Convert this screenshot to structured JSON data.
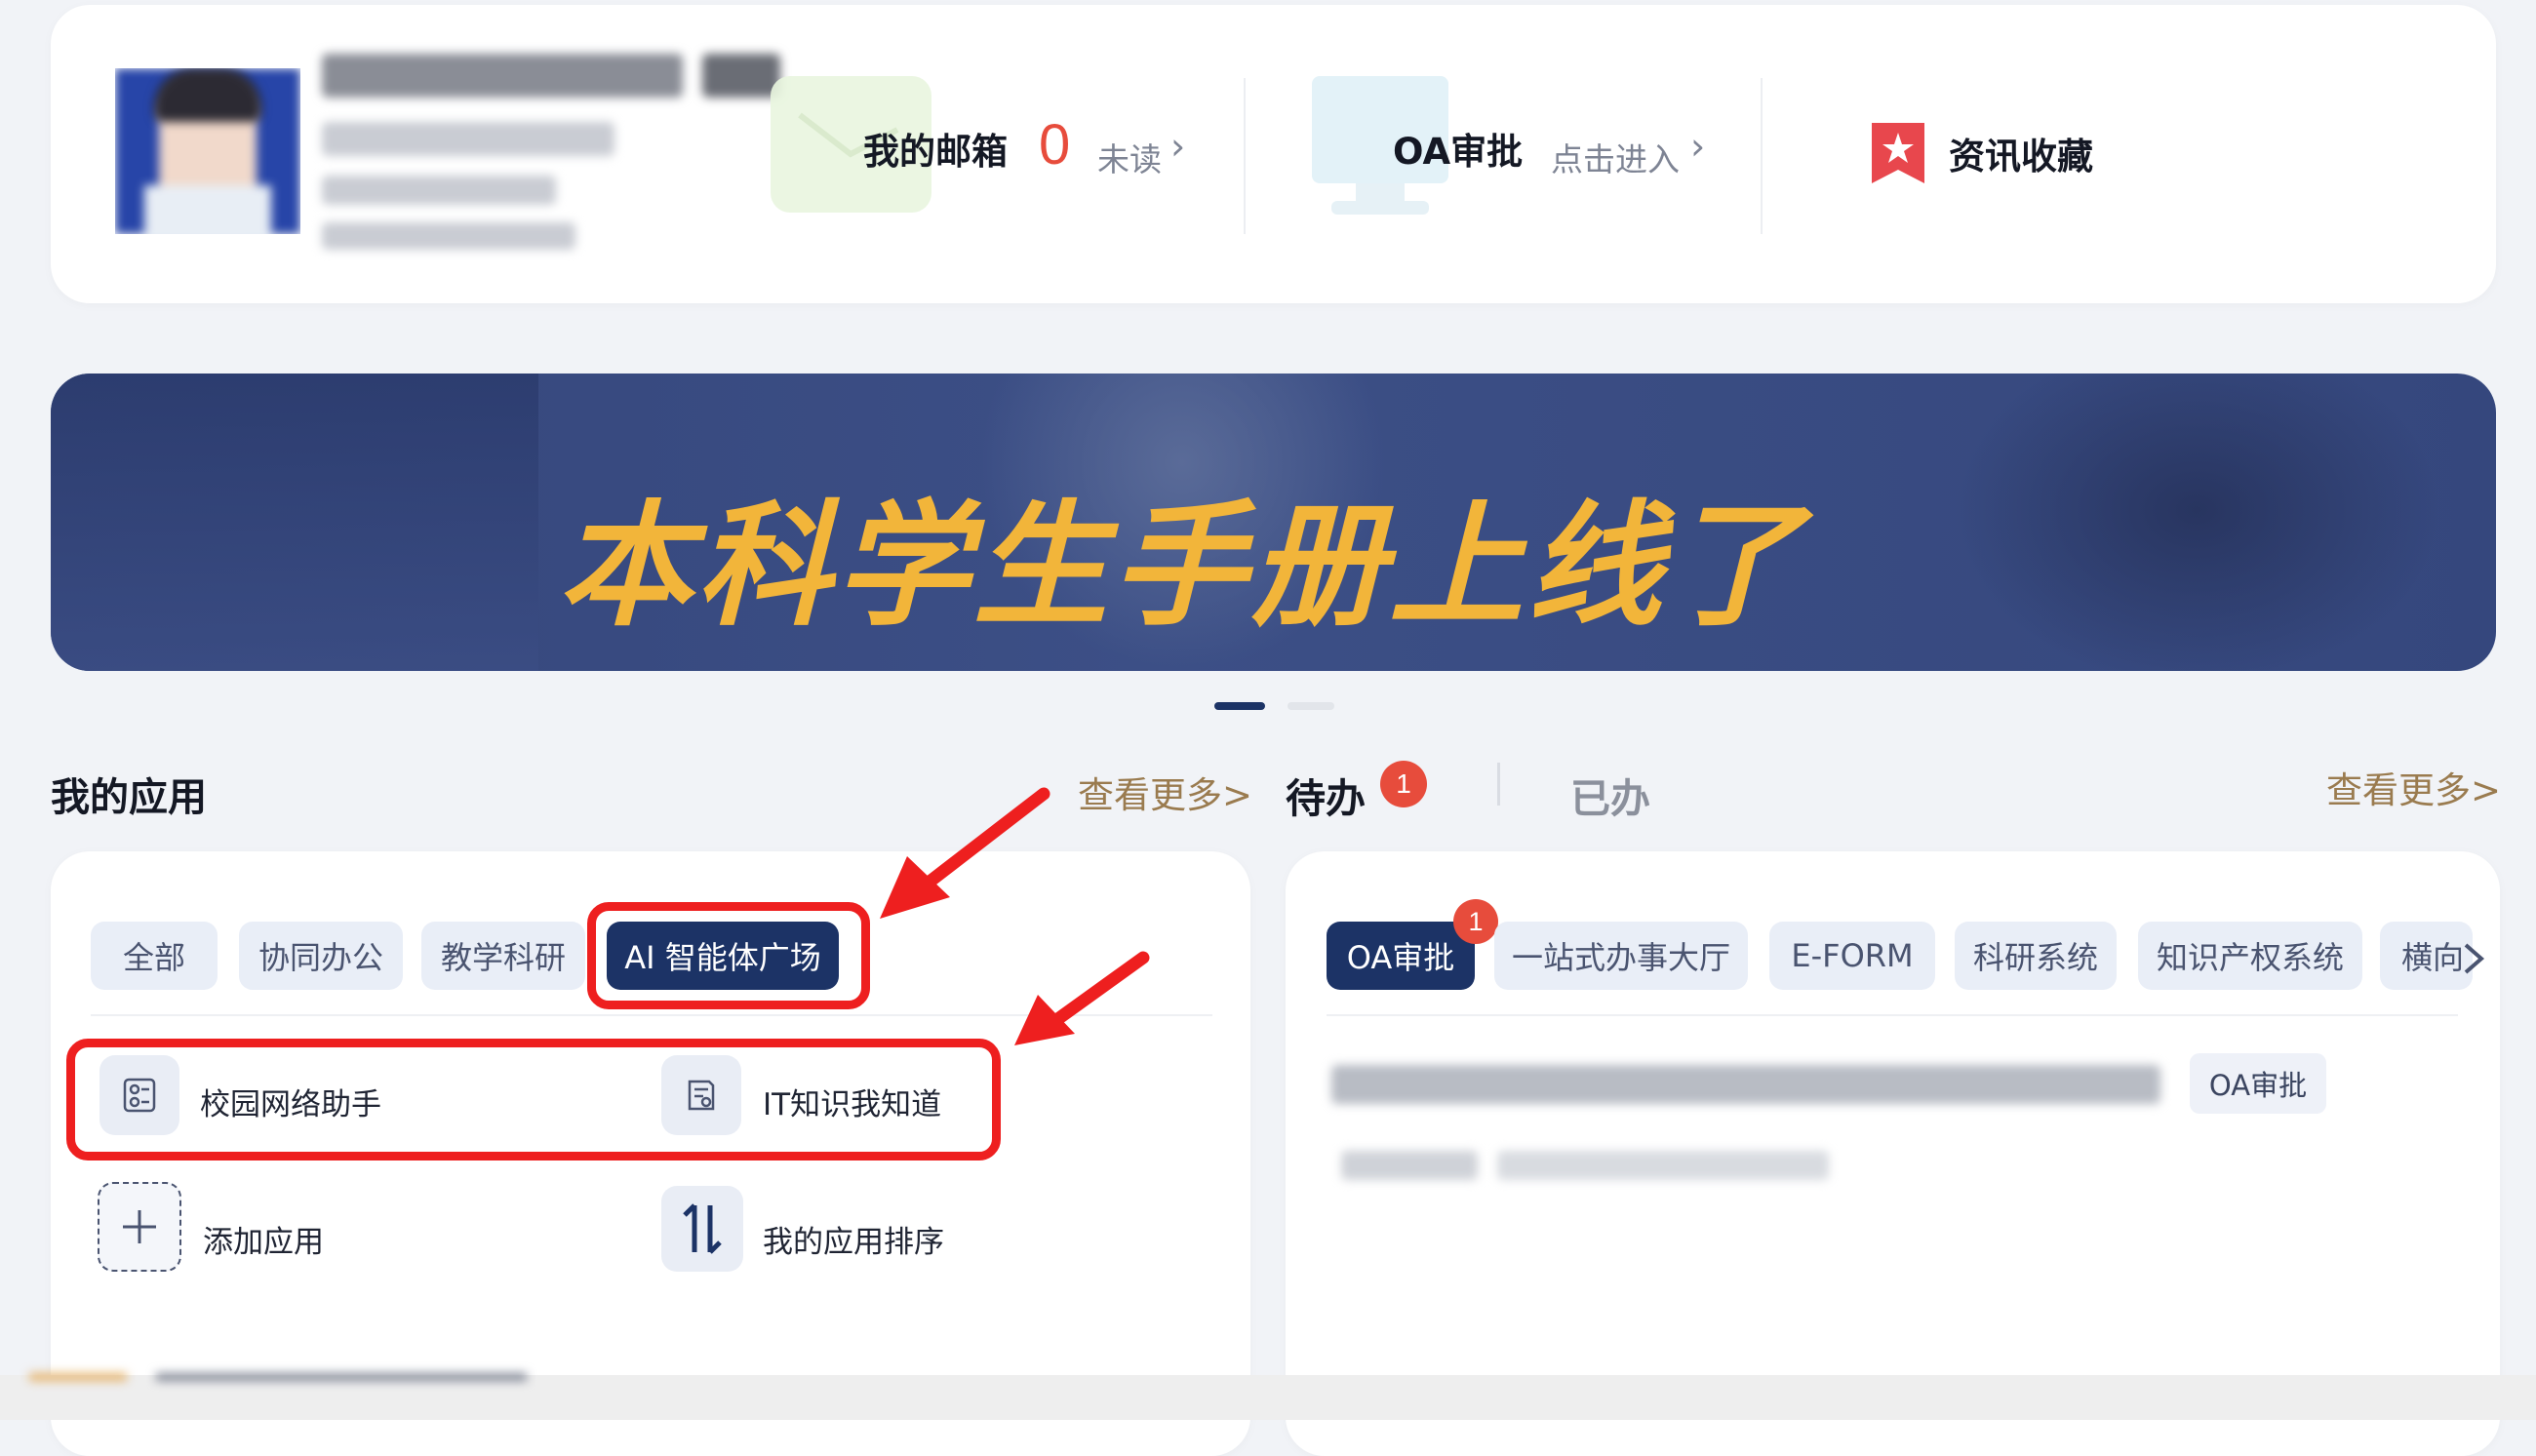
{
  "profile": {
    "avatar_alt": "avatar"
  },
  "quick": {
    "mail_label": "我的邮箱",
    "mail_count": "0",
    "mail_unread": "未读",
    "mail_arrow": "›",
    "oa_label": "OA审批",
    "oa_enter": "点击进入",
    "oa_arrow": "›",
    "fav_label": "资讯收藏"
  },
  "banner": {
    "text": "本科学生手册上线了"
  },
  "apps": {
    "section_title": "我的应用",
    "more": "查看更多>",
    "chips": [
      "全部",
      "协同办公",
      "教学科研",
      "AI 智能体广场"
    ],
    "items": [
      {
        "label": "校园网络助手",
        "icon": "network-assistant-icon"
      },
      {
        "label": "IT知识我知道",
        "icon": "knowledge-icon"
      },
      {
        "label": "添加应用",
        "icon": "plus-icon"
      },
      {
        "label": "我的应用排序",
        "icon": "sort-icon"
      }
    ]
  },
  "todo": {
    "tab_pending": "待办",
    "pending_badge": "1",
    "tab_done": "已办",
    "more": "查看更多>",
    "chips": [
      "OA审批",
      "一站式办事大厅",
      "E-FORM",
      "科研系统",
      "知识产权系统",
      "横向"
    ],
    "oa_badge": "1",
    "item_tag": "OA审批"
  },
  "colors": {
    "accent_navy": "#1c3366",
    "banner_text": "#f2b53a",
    "badge_red": "#e74c3c",
    "annotation_red": "#ee1f1f",
    "more_gold": "#9a7b4f"
  }
}
